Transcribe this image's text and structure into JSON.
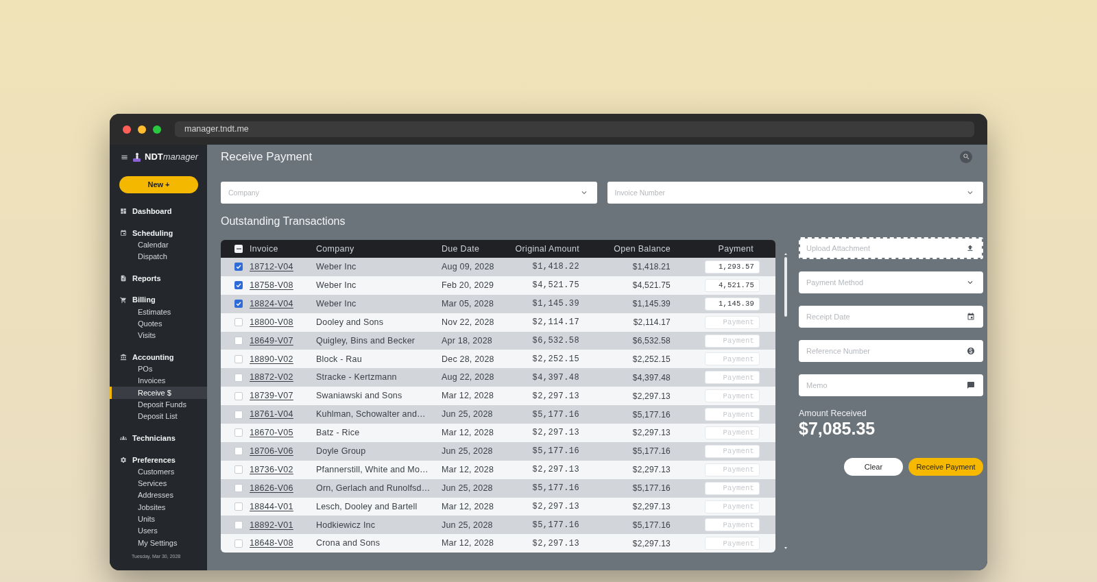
{
  "window": {
    "url": "manager.tndt.me"
  },
  "sidebar": {
    "logo": {
      "bold": "NDT",
      "italic": "manager"
    },
    "new_button": "New +",
    "sections": [
      {
        "label": "Dashboard",
        "selected": false
      },
      {
        "label": "Scheduling",
        "selected": false,
        "children": [
          {
            "label": "Calendar",
            "selected": false
          },
          {
            "label": "Dispatch",
            "selected": false
          }
        ]
      },
      {
        "label": "Reports",
        "selected": false
      },
      {
        "label": "Billing",
        "selected": false,
        "children": [
          {
            "label": "Estimates",
            "selected": false
          },
          {
            "label": "Quotes",
            "selected": false
          },
          {
            "label": "Visits",
            "selected": false
          }
        ]
      },
      {
        "label": "Accounting",
        "selected": false,
        "children": [
          {
            "label": "POs",
            "selected": false
          },
          {
            "label": "Invoices",
            "selected": false
          },
          {
            "label": "Receive $",
            "selected": true
          },
          {
            "label": "Deposit Funds",
            "selected": false
          },
          {
            "label": "Deposit List",
            "selected": false
          }
        ]
      },
      {
        "label": "Technicians",
        "selected": false
      },
      {
        "label": "Preferences",
        "selected": false,
        "children": [
          {
            "label": "Customers",
            "selected": false
          },
          {
            "label": "Services",
            "selected": false
          },
          {
            "label": "Addresses",
            "selected": false
          },
          {
            "label": "Jobsites",
            "selected": false
          },
          {
            "label": "Units",
            "selected": false
          },
          {
            "label": "Users",
            "selected": false
          },
          {
            "label": "My Settings",
            "selected": false
          }
        ]
      }
    ],
    "date": "Tuesday, Mar 30, 2028"
  },
  "page": {
    "title": "Receive Payment"
  },
  "filters": [
    {
      "placeholder": "Company"
    },
    {
      "placeholder": "Invoice Number"
    }
  ],
  "transactions": {
    "title": "Outstanding Transactions",
    "select_all": {
      "indeterminate": true
    },
    "columns": [
      "Invoice",
      "Company",
      "Due Date",
      "Original Amount",
      "Open Balance",
      "Payment"
    ],
    "rows": [
      {
        "checked": true,
        "invoice": "18712-V04",
        "company": "Weber Inc",
        "due_date": "Aug 09, 2028",
        "original_amount": "$1,418.22",
        "open_balance": "$1,418.21",
        "payment": {
          "value": "1,293.57"
        }
      },
      {
        "checked": true,
        "invoice": "18758-V08",
        "company": "Weber Inc",
        "due_date": "Feb 20, 2029",
        "original_amount": "$4,521.75",
        "open_balance": "$4,521.75",
        "payment": {
          "value": "4,521.75"
        }
      },
      {
        "checked": true,
        "invoice": "18824-V04",
        "company": "Weber Inc",
        "due_date": "Mar 05, 2028",
        "original_amount": "$1,145.39",
        "open_balance": "$1,145.39",
        "payment": {
          "value": "1,145.39"
        }
      },
      {
        "checked": false,
        "invoice": "18800-V08",
        "company": "Dooley and Sons",
        "due_date": "Nov 22, 2028",
        "original_amount": "$2,114.17",
        "open_balance": "$2,114.17",
        "payment": {
          "placeholder": "Payment"
        }
      },
      {
        "checked": false,
        "invoice": "18649-V07",
        "company": "Quigley, Bins and Becker",
        "due_date": "Apr 18, 2028",
        "original_amount": "$6,532.58",
        "open_balance": "$6,532.58",
        "payment": {
          "placeholder": "Payment"
        }
      },
      {
        "checked": false,
        "invoice": "18890-V02",
        "company": "Block - Rau",
        "due_date": "Dec 28, 2028",
        "original_amount": "$2,252.15",
        "open_balance": "$2,252.15",
        "payment": {
          "placeholder": "Payment"
        }
      },
      {
        "checked": false,
        "invoice": "18872-V02",
        "company": "Stracke - Kertzmann",
        "due_date": "Aug 22, 2028",
        "original_amount": "$4,397.48",
        "open_balance": "$4,397.48",
        "payment": {
          "placeholder": "Payment"
        }
      },
      {
        "checked": false,
        "invoice": "18739-V07",
        "company": "Swaniawski and Sons",
        "due_date": "Mar 12, 2028",
        "original_amount": "$2,297.13",
        "open_balance": "$2,297.13",
        "payment": {
          "placeholder": "Payment"
        }
      },
      {
        "checked": false,
        "invoice": "18761-V04",
        "company": "Kuhlman, Schowalter and…",
        "due_date": "Jun 25, 2028",
        "original_amount": "$5,177.16",
        "open_balance": "$5,177.16",
        "payment": {
          "placeholder": "Payment"
        }
      },
      {
        "checked": false,
        "invoice": "18670-V05",
        "company": "Batz - Rice",
        "due_date": "Mar 12, 2028",
        "original_amount": "$2,297.13",
        "open_balance": "$2,297.13",
        "payment": {
          "placeholder": "Payment"
        }
      },
      {
        "checked": false,
        "invoice": "18706-V06",
        "company": "Doyle Group",
        "due_date": "Jun 25, 2028",
        "original_amount": "$5,177.16",
        "open_balance": "$5,177.16",
        "payment": {
          "placeholder": "Payment"
        }
      },
      {
        "checked": false,
        "invoice": "18736-V02",
        "company": "Pfannerstill, White and Mo…",
        "due_date": "Mar 12, 2028",
        "original_amount": "$2,297.13",
        "open_balance": "$2,297.13",
        "payment": {
          "placeholder": "Payment"
        }
      },
      {
        "checked": false,
        "invoice": "18626-V06",
        "company": "Orn, Gerlach and Runolfsd…",
        "due_date": "Jun 25, 2028",
        "original_amount": "$5,177.16",
        "open_balance": "$5,177.16",
        "payment": {
          "placeholder": "Payment"
        }
      },
      {
        "checked": false,
        "invoice": "18844-V01",
        "company": "Lesch, Dooley and Bartell",
        "due_date": "Mar 12, 2028",
        "original_amount": "$2,297.13",
        "open_balance": "$2,297.13",
        "payment": {
          "placeholder": "Payment"
        }
      },
      {
        "checked": false,
        "invoice": "18892-V01",
        "company": "Hodkiewicz Inc",
        "due_date": "Jun 25, 2028",
        "original_amount": "$5,177.16",
        "open_balance": "$5,177.16",
        "payment": {
          "placeholder": "Payment"
        }
      },
      {
        "checked": false,
        "invoice": "18648-V08",
        "company": "Crona and Sons",
        "due_date": "Mar 12, 2028",
        "original_amount": "$2,297.13",
        "open_balance": "$2,297.13",
        "payment": {
          "placeholder": "Payment"
        }
      }
    ]
  },
  "payment_form": {
    "upload": {
      "label": "Upload Attachment"
    },
    "fields": [
      {
        "kind": "select",
        "placeholder": "Payment Method"
      },
      {
        "kind": "date",
        "placeholder": "Receipt Date"
      },
      {
        "kind": "reference",
        "placeholder": "Reference Number"
      },
      {
        "kind": "memo",
        "placeholder": "Memo"
      }
    ],
    "amount_label": "Amount Received",
    "amount": "$7,085.35",
    "buttons": [
      {
        "kind": "secondary",
        "label": "Clear"
      },
      {
        "kind": "primary",
        "label": "Receive Payment"
      }
    ]
  }
}
